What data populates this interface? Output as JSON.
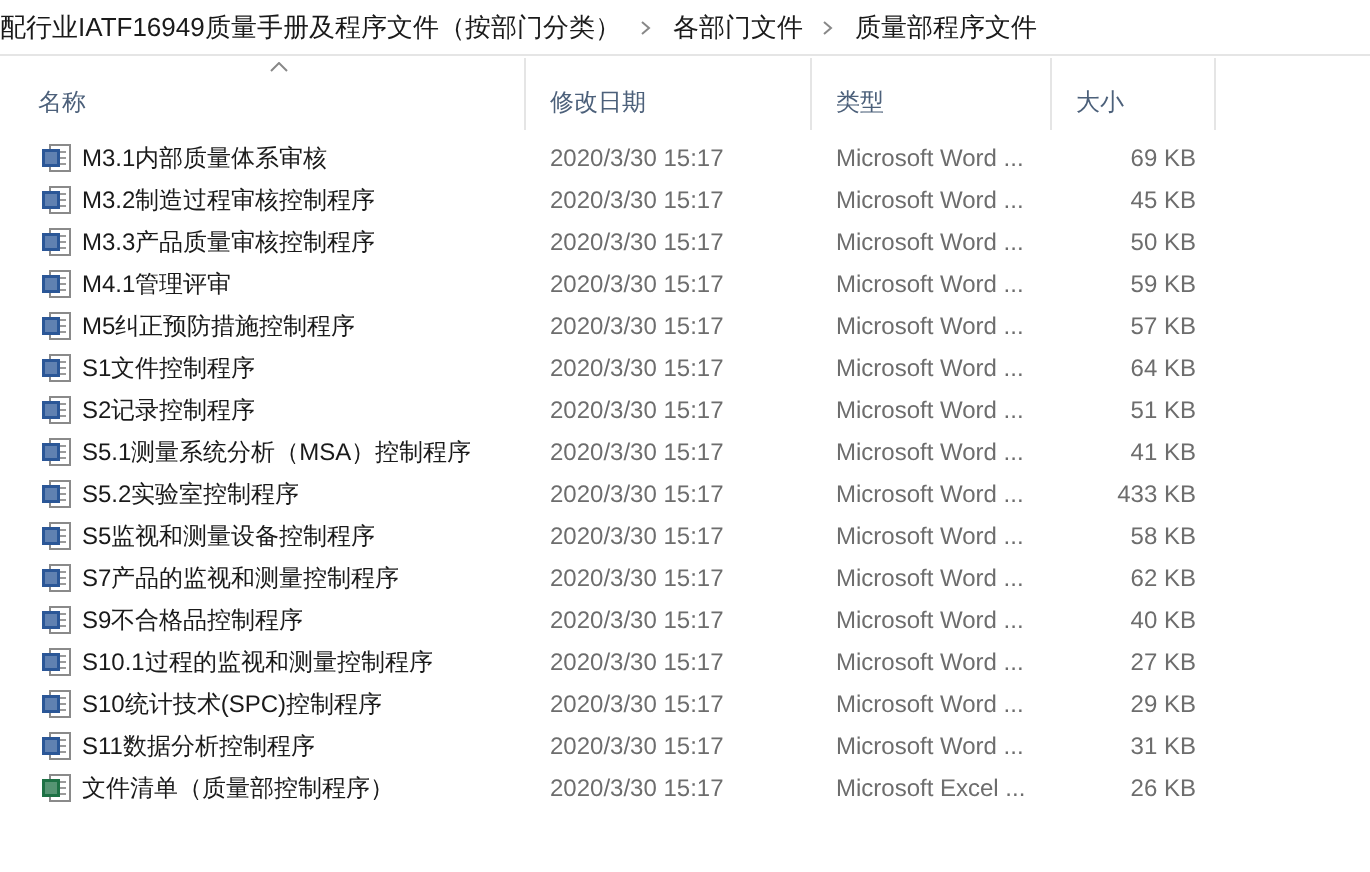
{
  "breadcrumb": [
    "配行业IATF16949质量手册及程序文件（按部门分类）",
    "各部门文件",
    "质量部程序文件"
  ],
  "columns": [
    {
      "label": "名称",
      "sorted": true
    },
    {
      "label": "修改日期",
      "sorted": false
    },
    {
      "label": "类型",
      "sorted": false
    },
    {
      "label": "大小",
      "sorted": false
    }
  ],
  "files": [
    {
      "kind": "word",
      "name": "M3.1内部质量体系审核",
      "date": "2020/3/30 15:17",
      "type": "Microsoft Word ...",
      "size": "69 KB"
    },
    {
      "kind": "word",
      "name": "M3.2制造过程审核控制程序",
      "date": "2020/3/30 15:17",
      "type": "Microsoft Word ...",
      "size": "45 KB"
    },
    {
      "kind": "word",
      "name": "M3.3产品质量审核控制程序",
      "date": "2020/3/30 15:17",
      "type": "Microsoft Word ...",
      "size": "50 KB"
    },
    {
      "kind": "word",
      "name": "M4.1管理评审",
      "date": "2020/3/30 15:17",
      "type": "Microsoft Word ...",
      "size": "59 KB"
    },
    {
      "kind": "word",
      "name": "M5纠正预防措施控制程序",
      "date": "2020/3/30 15:17",
      "type": "Microsoft Word ...",
      "size": "57 KB"
    },
    {
      "kind": "word",
      "name": "S1文件控制程序",
      "date": "2020/3/30 15:17",
      "type": "Microsoft Word ...",
      "size": "64 KB"
    },
    {
      "kind": "word",
      "name": "S2记录控制程序",
      "date": "2020/3/30 15:17",
      "type": "Microsoft Word ...",
      "size": "51 KB"
    },
    {
      "kind": "word",
      "name": "S5.1测量系统分析（MSA）控制程序",
      "date": "2020/3/30 15:17",
      "type": "Microsoft Word ...",
      "size": "41 KB"
    },
    {
      "kind": "word",
      "name": "S5.2实验室控制程序",
      "date": "2020/3/30 15:17",
      "type": "Microsoft Word ...",
      "size": "433 KB"
    },
    {
      "kind": "word",
      "name": "S5监视和测量设备控制程序",
      "date": "2020/3/30 15:17",
      "type": "Microsoft Word ...",
      "size": "58 KB"
    },
    {
      "kind": "word",
      "name": "S7产品的监视和测量控制程序",
      "date": "2020/3/30 15:17",
      "type": "Microsoft Word ...",
      "size": "62 KB"
    },
    {
      "kind": "word",
      "name": "S9不合格品控制程序",
      "date": "2020/3/30 15:17",
      "type": "Microsoft Word ...",
      "size": "40 KB"
    },
    {
      "kind": "word",
      "name": "S10.1过程的监视和测量控制程序",
      "date": "2020/3/30 15:17",
      "type": "Microsoft Word ...",
      "size": "27 KB"
    },
    {
      "kind": "word",
      "name": "S10统计技术(SPC)控制程序",
      "date": "2020/3/30 15:17",
      "type": "Microsoft Word ...",
      "size": "29 KB"
    },
    {
      "kind": "word",
      "name": "S11数据分析控制程序",
      "date": "2020/3/30 15:17",
      "type": "Microsoft Word ...",
      "size": "31 KB"
    },
    {
      "kind": "excel",
      "name": "文件清单（质量部控制程序）",
      "date": "2020/3/30 15:17",
      "type": "Microsoft Excel ...",
      "size": "26 KB"
    }
  ]
}
